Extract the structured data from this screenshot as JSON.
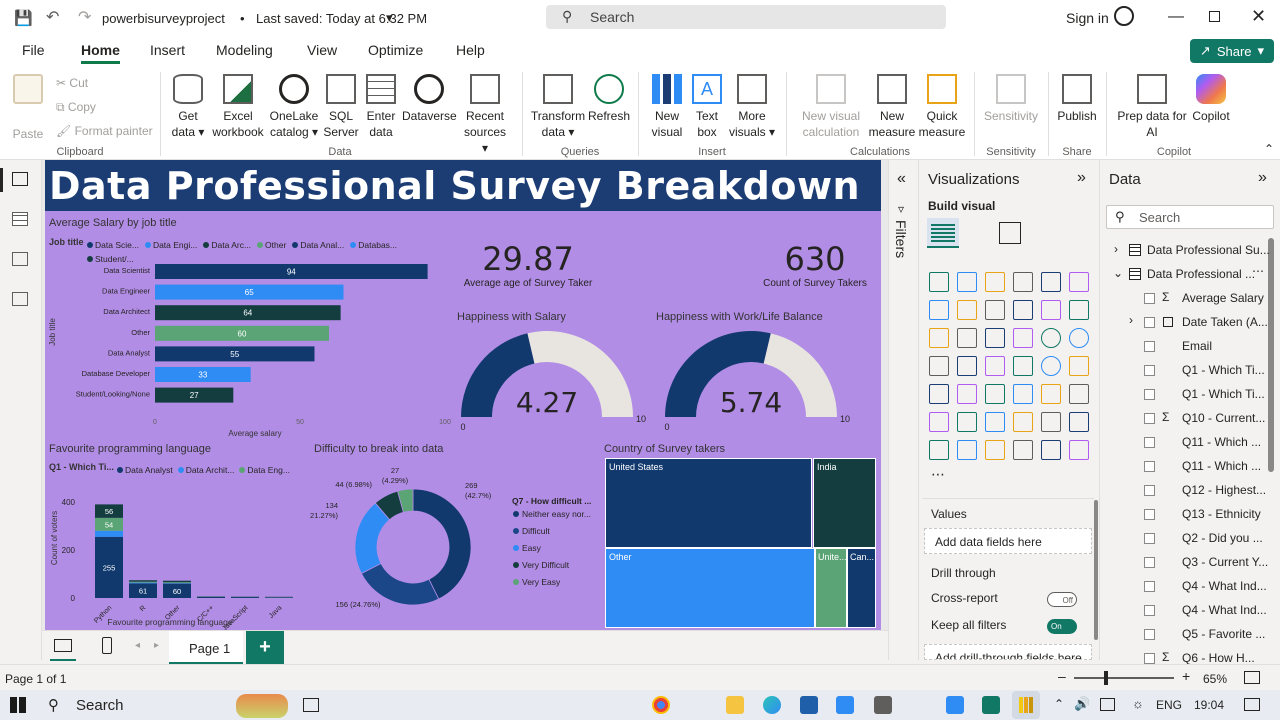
{
  "titlebar": {
    "file_name": "powerbisurveyproject",
    "saved": "Last saved: Today at 6:32 PM",
    "search_placeholder": "Search",
    "sign_in": "Sign in"
  },
  "tabs": [
    "File",
    "Home",
    "Insert",
    "Modeling",
    "View",
    "Optimize",
    "Help"
  ],
  "share_label": "Share",
  "ribbon": {
    "clipboard": {
      "paste": "Paste",
      "cut": "Cut",
      "copy": "Copy",
      "format_painter": "Format painter",
      "group": "Clipboard"
    },
    "data": {
      "get_data": "Get data",
      "excel": "Excel workbook",
      "onelake": "OneLake catalog",
      "sql": "SQL Server",
      "enter": "Enter data",
      "dataverse": "Dataverse",
      "recent": "Recent sources",
      "group": "Data"
    },
    "queries": {
      "transform": "Transform data",
      "refresh": "Refresh",
      "group": "Queries"
    },
    "insert": {
      "new_visual": "New visual",
      "text_box": "Text box",
      "more_visuals": "More visuals",
      "group": "Insert"
    },
    "calculations": {
      "new_visual_calc": "New visual calculation",
      "new_measure": "New measure",
      "quick_measure": "Quick measure",
      "group": "Calculations"
    },
    "sensitivity": {
      "label": "Sensitivity",
      "group": "Sensitivity"
    },
    "share": {
      "publish": "Publish",
      "group": "Share"
    },
    "copilot": {
      "prep": "Prep data for AI",
      "copilot": "Copilot",
      "group": "Copilot"
    }
  },
  "report": {
    "title": "Data Professional Survey Breakdown",
    "salary_chart": {
      "title": "Average Salary by job title",
      "legend_label": "Job title",
      "legend": [
        "Data Scie...",
        "Data Engi...",
        "Data Arc...",
        "Other",
        "Data Anal...",
        "Databas...",
        "Student/..."
      ],
      "ylabel": "Job title",
      "xlabel": "Average salary"
    },
    "kpi_age": {
      "value": "29.87",
      "label": "Average age of Survey Taker"
    },
    "kpi_count": {
      "value": "630",
      "label": "Count of Survey Takers"
    },
    "gauge_salary": {
      "title": "Happiness with Salary",
      "value": "4.27",
      "min": "0",
      "max": "10",
      "fraction": 0.427
    },
    "gauge_balance": {
      "title": "Happiness with Work/Life Balance",
      "value": "5.74",
      "min": "0",
      "max": "10",
      "fraction": 0.574
    },
    "lang_chart": {
      "title": "Favourite programming language",
      "legend_label": "Q1 - Which Ti...",
      "legend": [
        "Data Analyst",
        "Data Archit...",
        "Data Eng..."
      ],
      "ylabel": "Count of voters",
      "xlabel": "Favourite programming language"
    },
    "donut": {
      "title": "Difficulty to break into data",
      "legend_title": "Q7 - How difficult ...",
      "legend": [
        "Neither easy nor...",
        "Difficult",
        "Easy",
        "Very Difficult",
        "Very Easy"
      ],
      "labels": [
        "269 (42.7%)",
        "156 (24.76%)",
        "134 (21.27%)",
        "44 (6.98%)",
        "27 (4.29%)"
      ]
    },
    "treemap": {
      "title": "Country of Survey takers",
      "cells": [
        "United States",
        "India",
        "Other",
        "Unite...",
        "Can..."
      ]
    }
  },
  "chart_data": [
    {
      "type": "bar",
      "title": "Average Salary by job title",
      "orientation": "horizontal",
      "categories": [
        "Data Scientist",
        "Data Engineer",
        "Data Architect",
        "Other",
        "Data Analyst",
        "Database Developer",
        "Student/Looking/None"
      ],
      "values": [
        94,
        65,
        64,
        60,
        55,
        33,
        27
      ],
      "colors": [
        "#12396e",
        "#2f8cf5",
        "#133d3f",
        "#5ba475",
        "#12396e",
        "#2f8cf5",
        "#133d3f"
      ],
      "xlabel": "Average salary",
      "ylabel": "Job title",
      "xlim": [
        0,
        100
      ],
      "xticks": [
        "0",
        "50",
        "100"
      ]
    },
    {
      "type": "bar",
      "title": "Favourite programming language",
      "stacked": true,
      "categories": [
        "Python",
        "R",
        "Other",
        "C/C++",
        "JavaScript",
        "Java"
      ],
      "series": [
        {
          "name": "Data Analyst",
          "color": "#12396e",
          "values": [
            255,
            61,
            60,
            5,
            4,
            3
          ]
        },
        {
          "name": "Data Archit...",
          "color": "#2f8cf5",
          "values": [
            25,
            3,
            2,
            0,
            0,
            0
          ]
        },
        {
          "name": "Data Eng...",
          "color": "#5ba475",
          "values": [
            54,
            4,
            4,
            1,
            1,
            1
          ]
        },
        {
          "name": "",
          "color": "#133d3f",
          "values": [
            56,
            6,
            6,
            1,
            1,
            1
          ]
        }
      ],
      "segment_labels": [
        [
          "255",
          "",
          "54",
          "56"
        ],
        [
          "61",
          "",
          "",
          ""
        ],
        [
          "60",
          "",
          "",
          ""
        ],
        [],
        [],
        []
      ],
      "ylabel": "Count of voters",
      "xlabel": "Favourite programming language",
      "ylim": [
        0,
        450
      ],
      "yticks": [
        "0",
        "200",
        "400"
      ]
    },
    {
      "type": "pie",
      "title": "Difficulty to break into data",
      "categories": [
        "Neither easy nor...",
        "Difficult",
        "Easy",
        "Very Difficult",
        "Very Easy"
      ],
      "values": [
        269,
        156,
        134,
        44,
        27
      ],
      "colors": [
        "#12396e",
        "#1b4688",
        "#2f8cf5",
        "#133d3f",
        "#5ba475"
      ]
    },
    {
      "type": "heatmap",
      "title": "Country of Survey takers",
      "categories": [
        "United States",
        "India",
        "Other",
        "Unite...",
        "Can..."
      ],
      "colors": [
        "#12396e",
        "#133d3f",
        "#2f8cf5",
        "#5ba475",
        "#12396e"
      ]
    }
  ],
  "viz_pane": {
    "title": "Visualizations",
    "build_visual": "Build visual",
    "values_label": "Values",
    "add_fields": "Add data fields here",
    "drill_through": "Drill through",
    "cross_report": "Cross-report",
    "cross_report_state": "Off",
    "keep_filters": "Keep all filters",
    "keep_filters_state": "On",
    "add_drill": "Add drill-through fields here"
  },
  "filters_label": "Filters",
  "data_pane": {
    "title": "Data",
    "search_placeholder": "Search",
    "tables": [
      "Data Professional Su...",
      "Data Professional ..."
    ],
    "fields": [
      "Average Salary",
      "Date Taken (A...",
      "Email",
      "Q1 - Which Ti...",
      "Q1 - Which Ti...",
      "Q10 - Current...",
      "Q11 - Which ...",
      "Q11 - Which ...",
      "Q12 - Highest...",
      "Q13 - Ethnicity",
      "Q2 - Did you ...",
      "Q3 - Current Y...",
      "Q4 - What Ind...",
      "Q4 - What Ind...",
      "Q5 - Favorite ...",
      "Q6 - How H..."
    ]
  },
  "pages": {
    "page1": "Page 1",
    "add": "+"
  },
  "status": {
    "page": "Page 1 of 1",
    "zoom": "65%"
  },
  "taskbar": {
    "search": "Search",
    "lang": "ENG",
    "time": "19:04"
  }
}
